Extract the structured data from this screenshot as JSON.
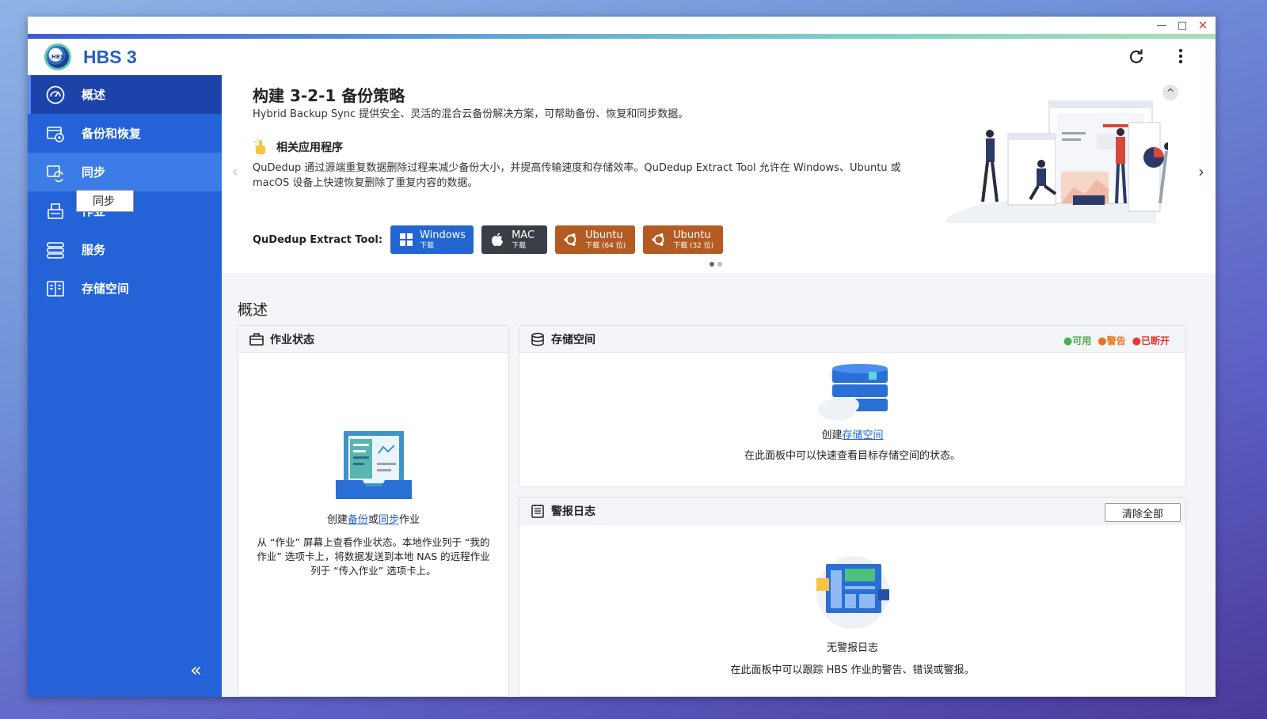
{
  "app": {
    "title": "HBS 3",
    "logo_text": "HBS"
  },
  "window_controls": {
    "minimize": "—",
    "maximize": "□",
    "close": "✕"
  },
  "header": {
    "refresh_icon": "refresh-icon",
    "more_icon": "more-vert-icon"
  },
  "sidebar": {
    "items": [
      {
        "label": "概述",
        "icon": "dashboard-icon"
      },
      {
        "label": "备份和恢复",
        "icon": "backup-restore-icon"
      },
      {
        "label": "同步",
        "icon": "sync-icon"
      },
      {
        "label": "作业",
        "icon": "jobs-icon"
      },
      {
        "label": "服务",
        "icon": "services-icon"
      },
      {
        "label": "存储空间",
        "icon": "storage-icon"
      }
    ],
    "tooltip": "同步",
    "collapse": "«"
  },
  "banner": {
    "title": "构建 3-2-1 备份策略",
    "subtitle": "Hybrid Backup Sync 提供安全、灵活的混合云备份解决方案，可帮助备份、恢复和同步数据。",
    "related_title": "相关应用程序",
    "related_text": "QuDedup 通过源端重复数据删除过程来减少备份大小，并提高传输速度和存储效率。QuDedup Extract Tool 允许在 Windows、Ubuntu 或 macOS 设备上快速恢复删除了重复内容的数据。",
    "tool_label": "QuDedup Extract Tool:",
    "buttons": [
      {
        "name": "Windows",
        "sub": "下载"
      },
      {
        "name": "MAC",
        "sub": "下载"
      },
      {
        "name": "Ubuntu",
        "sub": "下载 (64 位)"
      },
      {
        "name": "Ubuntu",
        "sub": "下载 (32 位)"
      }
    ],
    "prev": "‹",
    "next": "›",
    "collapse": "^"
  },
  "overview": {
    "title": "概述",
    "job_status": {
      "title": "作业状态",
      "create_prefix": "创建",
      "link_backup": "备份",
      "or": "或",
      "link_sync": "同步",
      "create_suffix": "作业",
      "desc": "从 “作业” 屏幕上查看作业状态。本地作业列于 “我的作业” 选项卡上，将数据发送到本地 NAS 的远程作业列于 “传入作业” 选项卡上。"
    },
    "storage": {
      "title": "存储空间",
      "legend": [
        {
          "label": "可用",
          "color": "#4caf50"
        },
        {
          "label": "警告",
          "color": "#e8761f"
        },
        {
          "label": "已断开",
          "color": "#e53935"
        }
      ],
      "create_prefix": "创建",
      "link_storage": "存储空间",
      "desc": "在此面板中可以快速查看目标存储空间的状态。"
    },
    "alerts": {
      "title": "警报日志",
      "clear_all": "清除全部",
      "empty": "无警报日志",
      "desc": "在此面板中可以跟踪 HBS 作业的警告、错误或警报。"
    }
  }
}
